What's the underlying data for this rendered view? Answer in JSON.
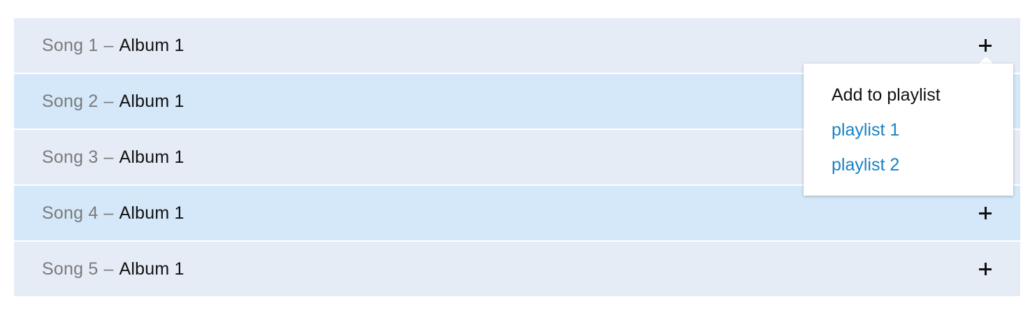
{
  "songs": [
    {
      "title": "Song 1",
      "separator": "–",
      "album": "Album 1"
    },
    {
      "title": "Song 2",
      "separator": "–",
      "album": "Album 1"
    },
    {
      "title": "Song 3",
      "separator": "–",
      "album": "Album 1"
    },
    {
      "title": "Song 4",
      "separator": "–",
      "album": "Album 1"
    },
    {
      "title": "Song 5",
      "separator": "–",
      "album": "Album 1"
    }
  ],
  "popover": {
    "title": "Add to playlist",
    "playlists": [
      "playlist 1",
      "playlist 2"
    ]
  },
  "icons": {
    "add": "plus-icon"
  },
  "colors": {
    "row_odd": "#e6ecf6",
    "row_even": "#d5e8f9",
    "link": "#1a82c4"
  }
}
